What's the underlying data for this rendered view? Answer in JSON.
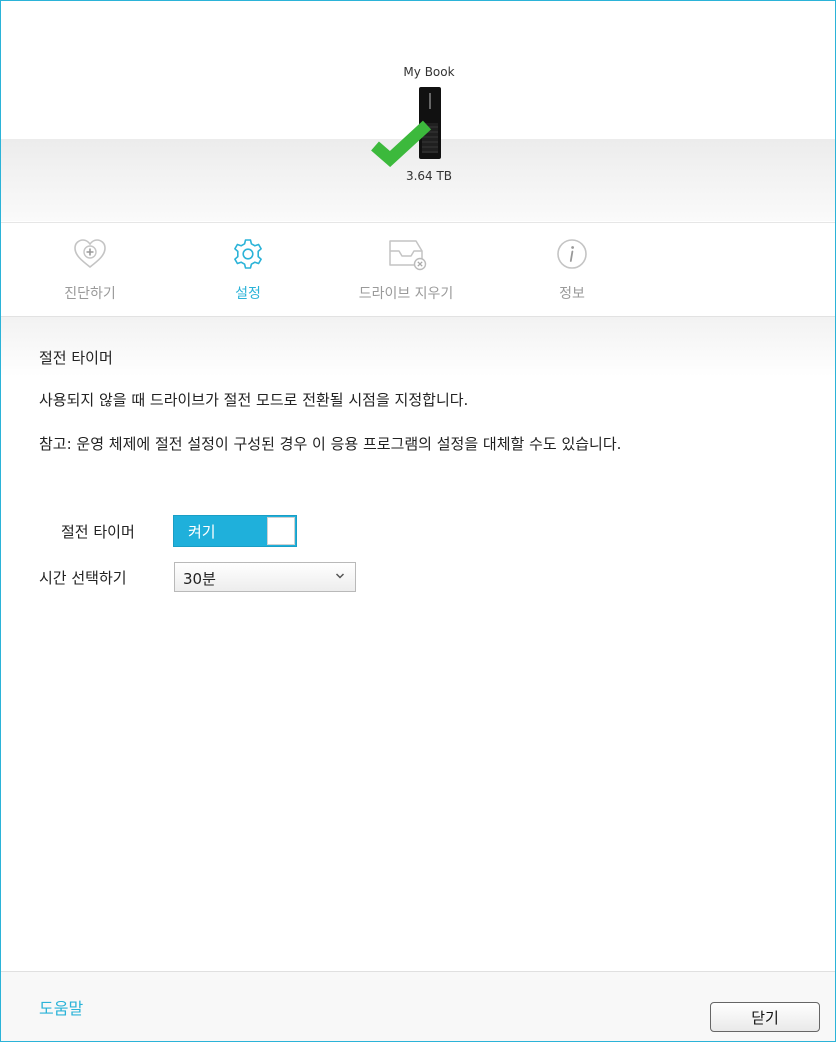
{
  "device": {
    "name": "My Book",
    "capacity": "3.64 TB",
    "status_icon": "check-icon"
  },
  "tabs": [
    {
      "label": "진단하기",
      "icon": "heart-plus-icon",
      "active": false
    },
    {
      "label": "설정",
      "icon": "gear-icon",
      "active": true
    },
    {
      "label": "드라이브 지우기",
      "icon": "erase-drive-icon",
      "active": false
    },
    {
      "label": "정보",
      "icon": "info-icon",
      "active": false
    }
  ],
  "content": {
    "section_title": "절전 타이머",
    "description": "사용되지 않을 때 드라이브가 절전 모드로 전환될 시점을 지정합니다.",
    "note": "참고: 운영 체제에 절전 설정이 구성된 경우 이 응용 프로그램의 설정을 대체할 수도 있습니다.",
    "sleep_timer": {
      "label": "절전 타이머",
      "toggle_text": "켜기",
      "on": true
    },
    "time_select": {
      "label": "시간 선택하기",
      "value": "30분"
    }
  },
  "footer": {
    "help_label": "도움말",
    "close_label": "닫기"
  },
  "colors": {
    "accent": "#2bb3d8",
    "toggle_on": "#1fb0db",
    "check_green": "#3cb93c",
    "inactive_tab": "#9a9a9a"
  }
}
